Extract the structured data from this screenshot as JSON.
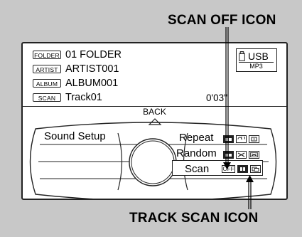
{
  "callouts": {
    "scan_off": "SCAN OFF ICON",
    "track_scan": "TRACK SCAN ICON"
  },
  "tracks": [
    {
      "tag": "FOLDER",
      "value": "01 FOLDER"
    },
    {
      "tag": "ARTIST",
      "value": "ARTIST001"
    },
    {
      "tag": "ALBUM",
      "value": "ALBUM001"
    },
    {
      "tag": "SCAN",
      "value": "Track01"
    }
  ],
  "playback_time": "0'03''",
  "source": {
    "name": "USB",
    "format": "MP3"
  },
  "back_label": "BACK",
  "menu": {
    "sound_setup": "Sound Setup",
    "repeat": "Repeat",
    "random": "Random",
    "scan": "Scan"
  },
  "icons": {
    "scan_off": "OFF"
  }
}
